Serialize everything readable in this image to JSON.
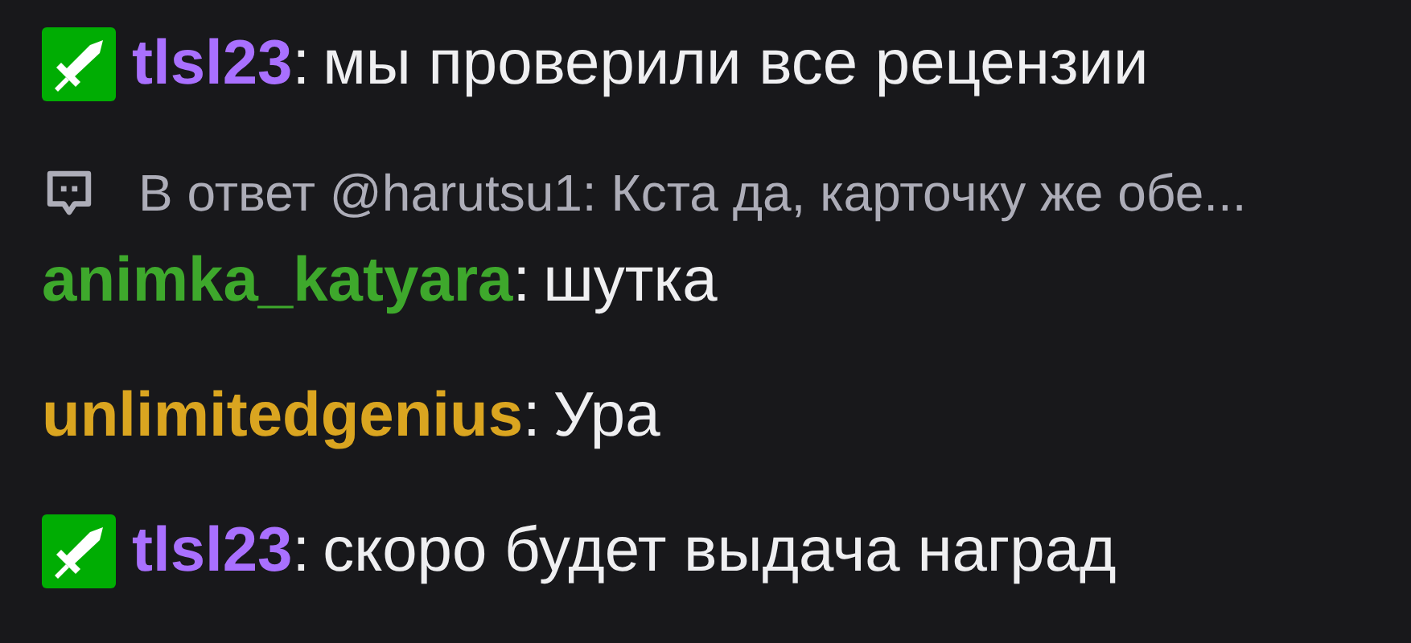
{
  "messages": [
    {
      "has_badge": true,
      "user": "tlsl23",
      "color": "#a970ff",
      "separator": ":",
      "text": "мы проверили все рецензии"
    },
    {
      "has_badge": false,
      "reply": "В ответ @harutsu1: Кста да, карточку же обе...",
      "user": "animka_katyara",
      "color": "#3ea82c",
      "separator": ":",
      "text": "шутка"
    },
    {
      "has_badge": false,
      "user": "unlimitedgenius",
      "color": "#daa520",
      "separator": ":",
      "text": "Ура"
    },
    {
      "has_badge": true,
      "user": "tlsl23",
      "color": "#a970ff",
      "separator": ":",
      "text": "скоро будет выдача наград"
    }
  ]
}
